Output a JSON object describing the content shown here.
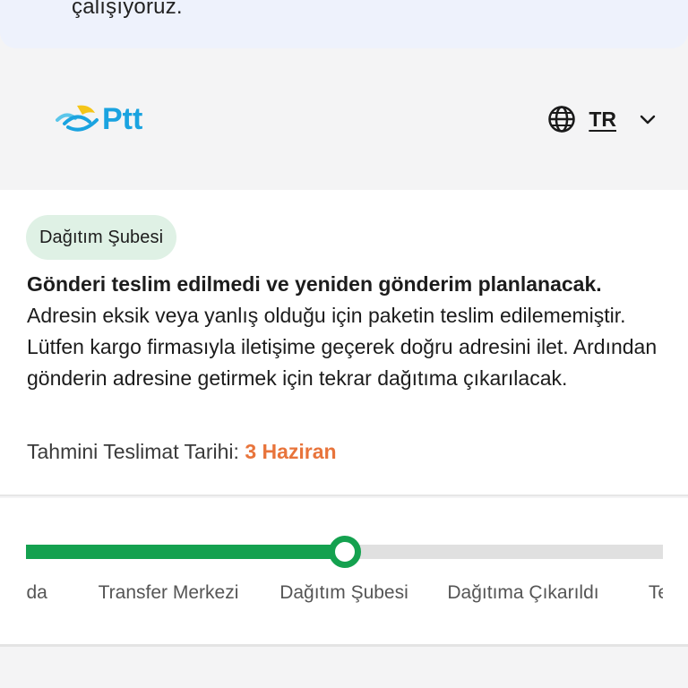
{
  "banner": {
    "text": "çalışıyoruz."
  },
  "header": {
    "logo_text": "Ptt",
    "language": {
      "code": "TR",
      "icon": "globe-icon",
      "chevron": "chevron-down-icon"
    }
  },
  "status": {
    "badge": "Dağıtım Şubesi",
    "title": "Gönderi teslim edilmedi ve yeniden gönderim planlanacak.",
    "body": "Adresin eksik veya yanlış olduğu için paketin teslim edilememiştir. Lütfen kargo firmasıyla iletişime geçerek doğru adresini ilet. Ardından gönderin adresine getirmek için tekrar dağıtıma çıkarılacak.",
    "eta_label": "Tahmini Teslimat Tarihi:",
    "eta_value": "3 Haziran"
  },
  "tracker": {
    "progress": 0.5,
    "steps": [
      "olda",
      "Transfer Merkezi",
      "Dağıtım Şubesi",
      "Dağıtıma Çıkarıldı",
      "Te"
    ],
    "colors": {
      "active": "#14a14f",
      "inactive": "#e0e0e0",
      "eta": "#e8743b",
      "logo": "#1aa3e0"
    }
  }
}
